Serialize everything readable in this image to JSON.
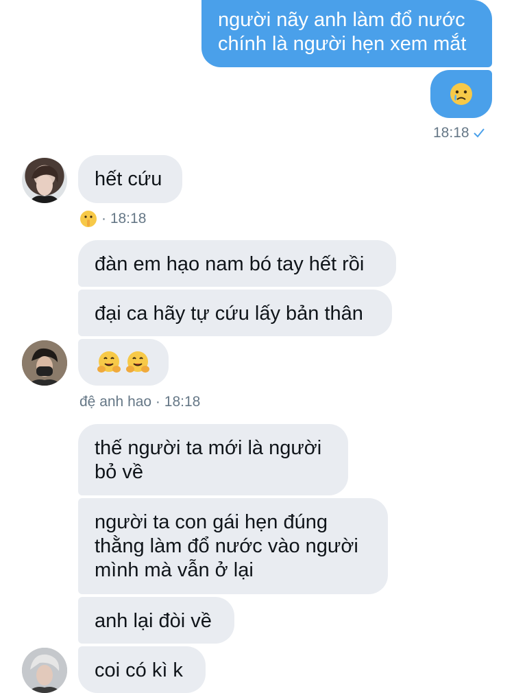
{
  "messages": {
    "out1": "người nãy anh làm đổ nước\nchính là người hẹn xem mắt",
    "out2_emoji": "crying-face",
    "out_time": "18:18",
    "in1": "hết cứu",
    "in1_reaction_emoji": "shushing-face",
    "in1_time": "· 18:18",
    "in2": "đàn em hạo nam bó tay hết rồi",
    "in3": "đại ca hãy tự cứu lấy bản thân",
    "in4_emoji": "hugging-face hugging-face",
    "in4_meta": "đệ anh hao · 18:18",
    "in5": "thế người ta mới là người\nbỏ về",
    "in6": "người ta con gái hẹn đúng\nthằng làm đổ nước vào người\nmình mà vẫn ở lại",
    "in7": "anh lại đòi về",
    "in8": "coi có kì k"
  },
  "colors": {
    "outgoing_bubble": "#4aa0ea",
    "incoming_bubble": "#e9ecf1",
    "meta_text": "#657786",
    "read_check": "#4aa0ea"
  }
}
